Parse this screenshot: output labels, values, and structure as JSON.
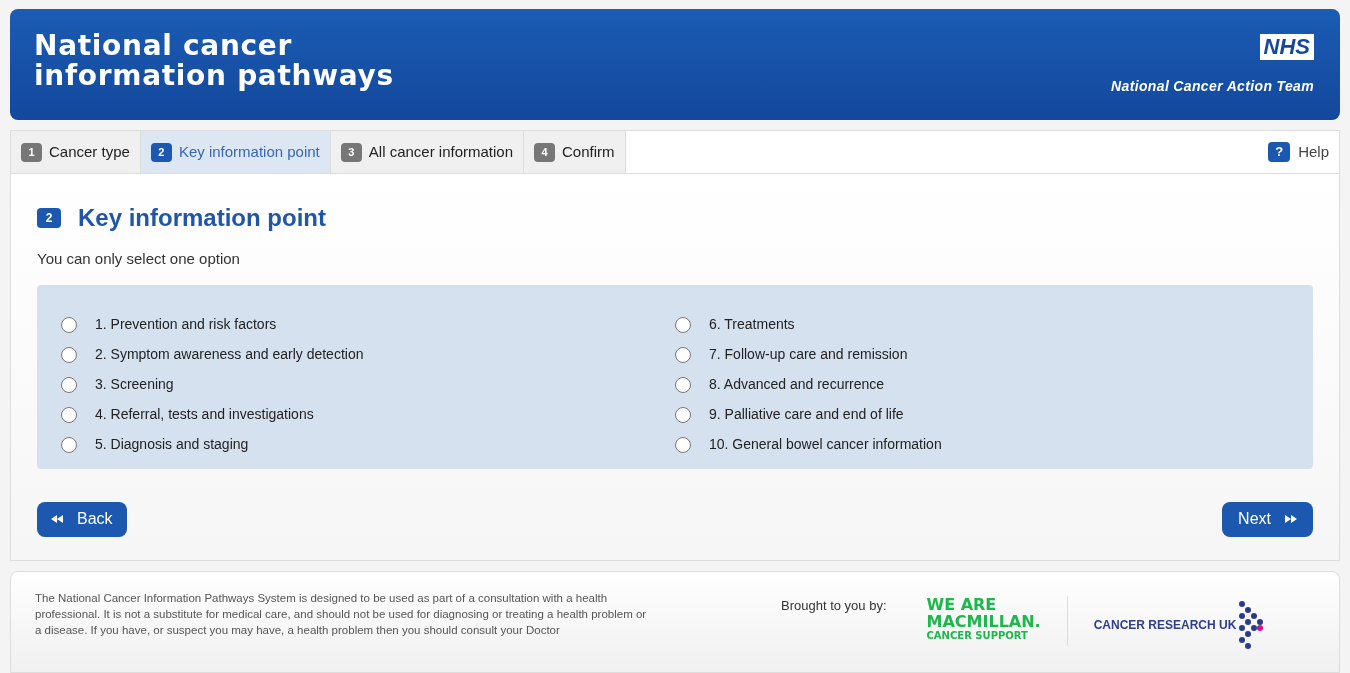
{
  "header": {
    "title_lines": [
      "National cancer",
      "information pathways"
    ],
    "badge": "NHS",
    "subtitle": "National Cancer Action Team"
  },
  "steps": [
    {
      "number": "1",
      "label": "Cancer type",
      "selected": false
    },
    {
      "number": "2",
      "label": "Key information point",
      "selected": true
    },
    {
      "number": "3",
      "label": "All cancer information",
      "selected": false
    },
    {
      "number": "4",
      "label": "Confirm",
      "selected": false
    }
  ],
  "help": {
    "icon_text": "?",
    "label": "Help"
  },
  "section": {
    "number": "2",
    "title": "Key information point",
    "instruction": "You can only select one option"
  },
  "options": [
    {
      "label": "1. Prevention and risk factors",
      "selected": false
    },
    {
      "label": "2. Symptom awareness and early detection",
      "selected": false
    },
    {
      "label": "3. Screening",
      "selected": false
    },
    {
      "label": "4. Referral, tests and investigations",
      "selected": false
    },
    {
      "label": "5. Diagnosis and staging",
      "selected": false
    },
    {
      "label": "6. Treatments",
      "selected": false
    },
    {
      "label": "7. Follow-up care and remission",
      "selected": false
    },
    {
      "label": "8. Advanced and recurrence",
      "selected": false
    },
    {
      "label": "9. Palliative care and end of life",
      "selected": false
    },
    {
      "label": "10. General bowel cancer information",
      "selected": false
    }
  ],
  "buttons": {
    "back": "Back",
    "next": "Next"
  },
  "footer": {
    "disclaimer": "The National Cancer Information Pathways System is designed to be used as part of a consultation with a health professional. It is not a substitute for medical care, and should not be used for diagnosing or treating a health problem or a disease. If you have, or suspect you may have, a health problem then you should consult your Doctor",
    "brought_by": "Brought to you by:",
    "macmillan_lines": [
      "WE ARE",
      "MACMILLAN.",
      "CANCER SUPPORT"
    ],
    "cruk": "CANCER RESEARCH UK"
  }
}
